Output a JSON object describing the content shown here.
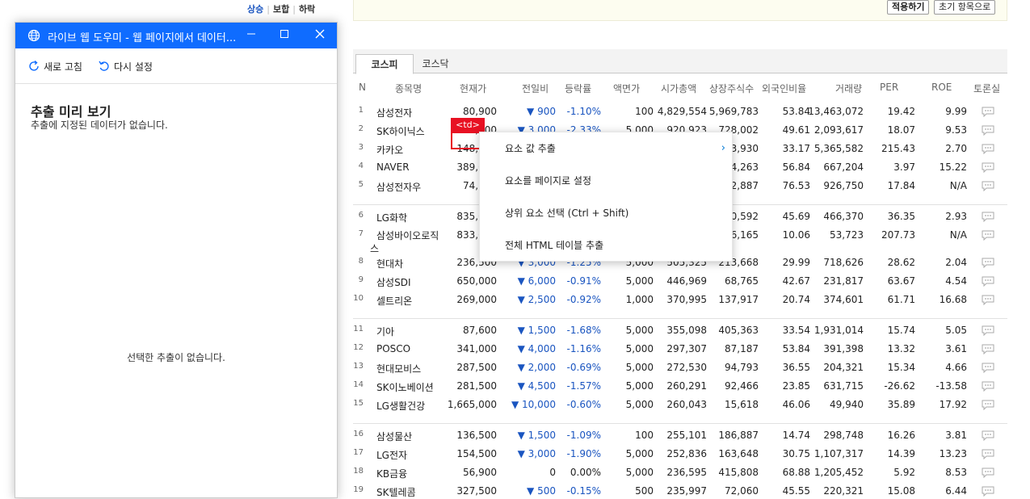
{
  "page": {
    "top_links": [
      "상승",
      "보합",
      "하락"
    ],
    "apply_label": "적용하기",
    "reset_label": "초기 항목으로",
    "tabs": [
      "코스피",
      "코스닥"
    ],
    "columns": [
      "N",
      "종목명",
      "현재가",
      "전일비",
      "등락률",
      "액면가",
      "시가총액",
      "상장주식수",
      "외국인비율",
      "거래량",
      "PER",
      "ROE",
      "토론실"
    ],
    "rows": [
      {
        "n": "1",
        "name": "삼성전자",
        "price": "80,900",
        "diff": "▼ 900",
        "rate": "-1.10%",
        "face": "100",
        "cap": "4,829,554",
        "shares": "5,969,783",
        "foreign": "53.84",
        "vol": "13,463,072",
        "per": "19.42",
        "roe": "9.99"
      },
      {
        "n": "2",
        "name": "SK하이닉스",
        "price": "125,500",
        "diff": "▼ 3,000",
        "rate": "-2.33%",
        "face": "5,000",
        "cap": "920,923",
        "shares": "728,002",
        "foreign": "49.61",
        "vol": "2,093,617",
        "per": "18.07",
        "roe": "9.53"
      },
      {
        "n": "3",
        "name": "카카오",
        "price": "148,500",
        "diff": "",
        "rate": "",
        "face": "",
        "cap": "",
        "shares": "443,930",
        "foreign": "33.17",
        "vol": "5,365,582",
        "per": "215.43",
        "roe": "2.70"
      },
      {
        "n": "4",
        "name": "NAVER",
        "price": "389,000",
        "diff": "",
        "rate": "",
        "face": "",
        "cap": "",
        "shares": "164,263",
        "foreign": "56.84",
        "vol": "667,204",
        "per": "3.97",
        "roe": "15.22"
      },
      {
        "n": "5",
        "name": "삼성전자우",
        "price": "74,700",
        "diff": "",
        "rate": "",
        "face": "",
        "cap": "",
        "shares": "822,887",
        "foreign": "76.53",
        "vol": "926,750",
        "per": "17.84",
        "roe": "N/A"
      },
      {
        "n": "6",
        "name": "LG화학",
        "price": "835,000",
        "diff": "",
        "rate": "",
        "face": "",
        "cap": "",
        "shares": "70,592",
        "foreign": "45.69",
        "vol": "466,370",
        "per": "36.35",
        "roe": "2.93"
      },
      {
        "n": "7",
        "name": "삼성바이오로직스",
        "price": "833,000",
        "diff": "",
        "rate": "",
        "face": "",
        "cap": "",
        "shares": "66,165",
        "foreign": "10.06",
        "vol": "53,723",
        "per": "207.73",
        "roe": "N/A"
      },
      {
        "n": "8",
        "name": "현대차",
        "price": "236,500",
        "diff": "▼ 3,000",
        "rate": "-1.25%",
        "face": "5,000",
        "cap": "505,325",
        "shares": "213,668",
        "foreign": "29.99",
        "vol": "718,626",
        "per": "28.62",
        "roe": "2.04"
      },
      {
        "n": "9",
        "name": "삼성SDI",
        "price": "650,000",
        "diff": "▼ 6,000",
        "rate": "-0.91%",
        "face": "5,000",
        "cap": "446,969",
        "shares": "68,765",
        "foreign": "42.67",
        "vol": "231,817",
        "per": "63.67",
        "roe": "4.54"
      },
      {
        "n": "10",
        "name": "셀트리온",
        "price": "269,000",
        "diff": "▼ 2,500",
        "rate": "-0.92%",
        "face": "1,000",
        "cap": "370,995",
        "shares": "137,917",
        "foreign": "20.74",
        "vol": "374,601",
        "per": "61.71",
        "roe": "16.68"
      },
      {
        "n": "11",
        "name": "기아",
        "price": "87,600",
        "diff": "▼ 1,500",
        "rate": "-1.68%",
        "face": "5,000",
        "cap": "355,098",
        "shares": "405,363",
        "foreign": "33.54",
        "vol": "1,931,014",
        "per": "15.74",
        "roe": "5.05"
      },
      {
        "n": "12",
        "name": "POSCO",
        "price": "341,000",
        "diff": "▼ 4,000",
        "rate": "-1.16%",
        "face": "5,000",
        "cap": "297,307",
        "shares": "87,187",
        "foreign": "53.84",
        "vol": "391,398",
        "per": "13.32",
        "roe": "3.61"
      },
      {
        "n": "13",
        "name": "현대모비스",
        "price": "287,500",
        "diff": "▼ 2,000",
        "rate": "-0.69%",
        "face": "5,000",
        "cap": "272,530",
        "shares": "94,793",
        "foreign": "36.55",
        "vol": "204,321",
        "per": "15.34",
        "roe": "4.66"
      },
      {
        "n": "14",
        "name": "SK이노베이션",
        "price": "281,500",
        "diff": "▼ 4,500",
        "rate": "-1.57%",
        "face": "5,000",
        "cap": "260,291",
        "shares": "92,466",
        "foreign": "23.85",
        "vol": "631,715",
        "per": "-26.62",
        "roe": "-13.58"
      },
      {
        "n": "15",
        "name": "LG생활건강",
        "price": "1,665,000",
        "diff": "▼ 10,000",
        "rate": "-0.60%",
        "face": "5,000",
        "cap": "260,043",
        "shares": "15,618",
        "foreign": "46.06",
        "vol": "49,940",
        "per": "35.89",
        "roe": "17.92"
      },
      {
        "n": "16",
        "name": "삼성물산",
        "price": "136,500",
        "diff": "▼ 1,500",
        "rate": "-1.09%",
        "face": "100",
        "cap": "255,101",
        "shares": "186,887",
        "foreign": "14.74",
        "vol": "298,748",
        "per": "16.26",
        "roe": "3.81"
      },
      {
        "n": "17",
        "name": "LG전자",
        "price": "154,500",
        "diff": "▼ 3,000",
        "rate": "-1.90%",
        "face": "5,000",
        "cap": "252,836",
        "shares": "163,648",
        "foreign": "30.75",
        "vol": "1,107,317",
        "per": "14.39",
        "roe": "13.23"
      },
      {
        "n": "18",
        "name": "KB금융",
        "price": "56,900",
        "diff": "0",
        "rate": "0.00%",
        "face": "5,000",
        "cap": "236,595",
        "shares": "415,808",
        "foreign": "68.88",
        "vol": "1,205,452",
        "per": "5.92",
        "roe": "8.53"
      },
      {
        "n": "19",
        "name": "SK텔레콤",
        "price": "327,500",
        "diff": "▼ 500",
        "rate": "-0.15%",
        "face": "500",
        "cap": "235,997",
        "shares": "72,060",
        "foreign": "45.55",
        "vol": "220,321",
        "per": "15.08",
        "roe": "6.44"
      }
    ]
  },
  "highlight": {
    "tag": "<td>"
  },
  "context_menu": {
    "items": [
      "요소 값 추출",
      "요소를 페이지로 설정",
      "상위 요소 선택  (Ctrl + Shift)",
      "전체 HTML 테이블 추출"
    ]
  },
  "helper_pane": {
    "title": "라이브 웹 도우미 - 웹 페이지에서 데이터...",
    "refresh_label": "새로 고침",
    "reset_label": "다시 설정",
    "preview_title": "추출 미리 보기",
    "preview_subtitle": "추출에 지정된 데이터가 없습니다.",
    "empty_message": "선택한 추출이 없습니다."
  },
  "colors": {
    "accent": "#0f6cff",
    "highlight": "#e81123",
    "down": "#1a55c0"
  }
}
